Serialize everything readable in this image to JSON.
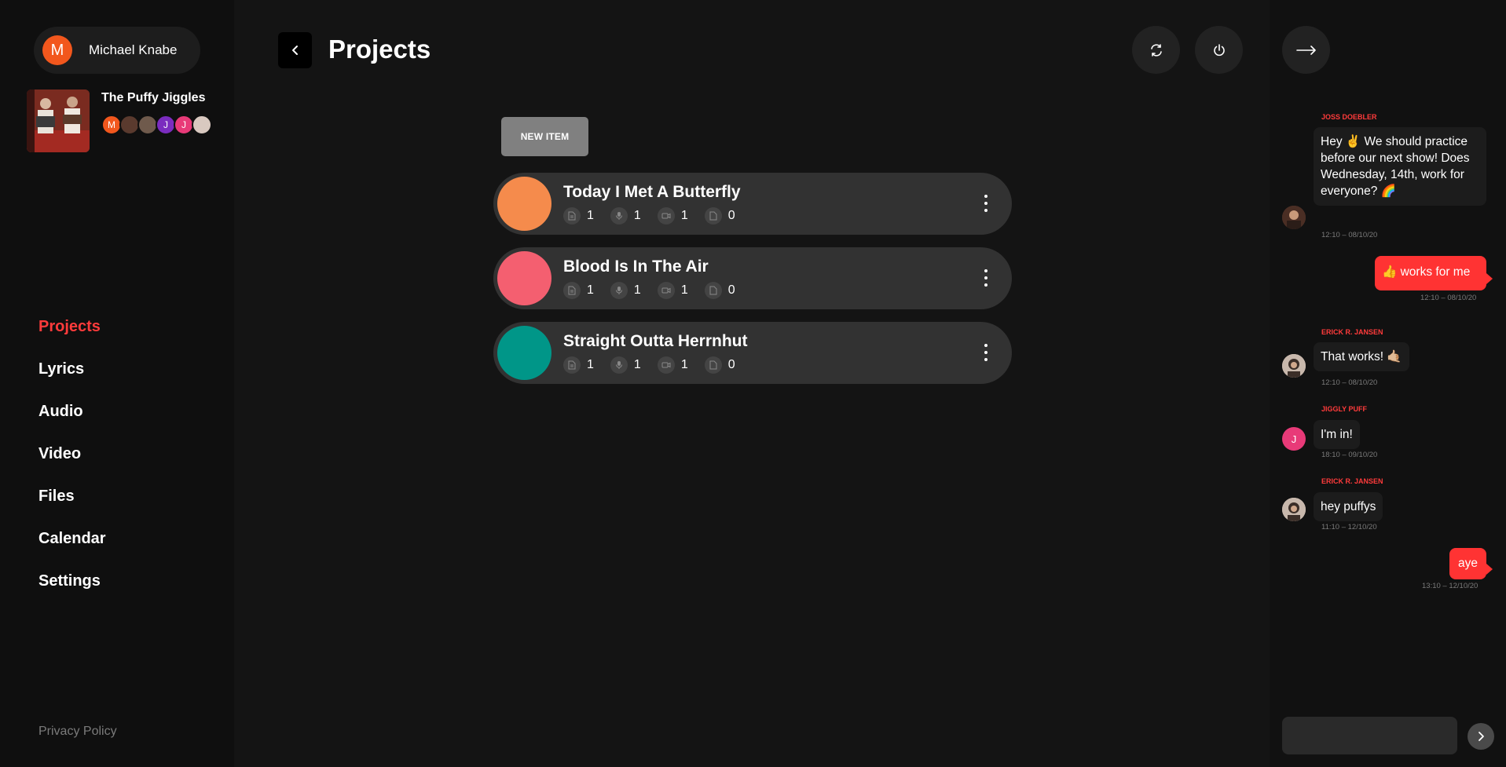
{
  "user": {
    "initial": "M",
    "name": "Michael Knabe"
  },
  "band": {
    "name": "The Puffy Jiggles",
    "members": [
      {
        "initial": "M",
        "color": "#f2571d"
      },
      {
        "initial": "",
        "color": "#5a3a2e"
      },
      {
        "initial": "",
        "color": "#6f5a4c"
      },
      {
        "initial": "J",
        "color": "#7b2cbf"
      },
      {
        "initial": "J",
        "color": "#e83a78"
      },
      {
        "initial": "",
        "color": "#d9c9c0"
      }
    ]
  },
  "nav": {
    "items": [
      {
        "label": "Projects",
        "active": true
      },
      {
        "label": "Lyrics",
        "active": false
      },
      {
        "label": "Audio",
        "active": false
      },
      {
        "label": "Video",
        "active": false
      },
      {
        "label": "Files",
        "active": false
      },
      {
        "label": "Calendar",
        "active": false
      },
      {
        "label": "Settings",
        "active": false
      }
    ],
    "privacy": "Privacy Policy"
  },
  "main": {
    "title": "Projects",
    "new_item_label": "NEW ITEM",
    "projects": [
      {
        "name": "Today I Met A Butterfly",
        "color": "#f58b4c",
        "lyrics": "1",
        "audio": "1",
        "video": "1",
        "files": "0"
      },
      {
        "name": "Blood Is In The Air",
        "color": "#f45f70",
        "lyrics": "1",
        "audio": "1",
        "video": "1",
        "files": "0"
      },
      {
        "name": "Straight Outta Herrnhut",
        "color": "#009688",
        "lyrics": "1",
        "audio": "1",
        "video": "1",
        "files": "0"
      }
    ]
  },
  "chat": {
    "messages": [
      {
        "author": "JOSS DOEBLER",
        "text": "Hey ✌️ We should practice before our next show! Does Wednesday, 14th, work for everyone? 🌈",
        "time": "12:10 – 08/10/20",
        "own": false
      },
      {
        "author": "",
        "text": "👍 works for me",
        "time": "12:10 – 08/10/20",
        "own": true
      },
      {
        "author": "ERICK R. JANSEN",
        "text": "That works! 🤙🏼",
        "time": "12:10 – 08/10/20",
        "own": false
      },
      {
        "author": "JIGGLY PUFF",
        "text": "I'm in!",
        "time": "18:10 – 09/10/20",
        "own": false,
        "avatar_initial": "J"
      },
      {
        "author": "ERICK R. JANSEN",
        "text": "hey puffys",
        "time": "11:10 – 12/10/20",
        "own": false
      },
      {
        "author": "",
        "text": "aye",
        "time": "13:10 – 12/10/20",
        "own": true
      }
    ],
    "input_placeholder": ""
  },
  "colors": {
    "accent": "#ff3b3b",
    "own_bubble": "#ff3333"
  }
}
